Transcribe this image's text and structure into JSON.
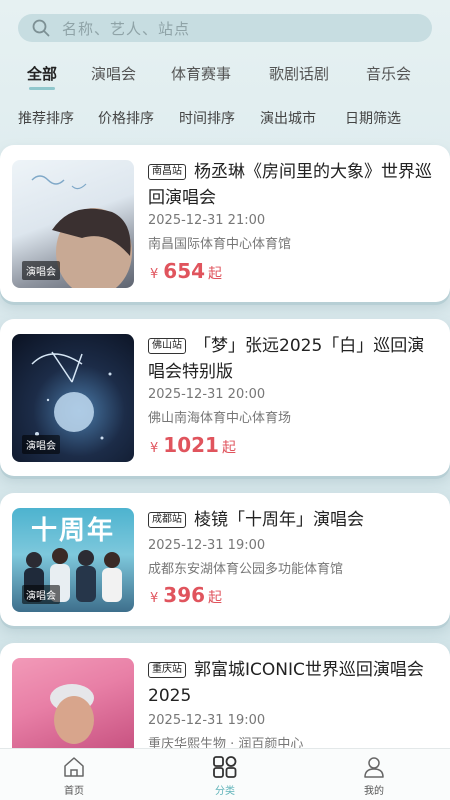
{
  "search": {
    "placeholder": "名称、艺人、站点"
  },
  "tabs": [
    "全部",
    "演唱会",
    "体育赛事",
    "歌剧话剧",
    "音乐会"
  ],
  "sorts": [
    "推荐排序",
    "价格排序",
    "时间排序",
    "演出城市",
    "日期筛选"
  ],
  "events": [
    {
      "city": "南昌站",
      "title": "杨丞琳《房间里的大象》世界巡回演唱会",
      "datetime": "2025-12-31 21:00",
      "venue": "南昌国际体育中心体育馆",
      "price_symbol": "¥",
      "price": "654",
      "price_suffix": "起",
      "poster_tag": "演唱会"
    },
    {
      "city": "佛山站",
      "title": "「梦」张远2025「白」巡回演唱会特别版",
      "datetime": "2025-12-31 20:00",
      "venue": "佛山南海体育中心体育场",
      "price_symbol": "¥",
      "price": "1021",
      "price_suffix": "起",
      "poster_tag": "演唱会"
    },
    {
      "city": "成都站",
      "title": "棱镜「十周年」演唱会",
      "datetime": "2025-12-31 19:00",
      "venue": "成都东安湖体育公园多功能体育馆",
      "price_symbol": "¥",
      "price": "396",
      "price_suffix": "起",
      "poster_tag": "演唱会",
      "poster_text": "十周年"
    },
    {
      "city": "重庆站",
      "title": "郭富城ICONIC世界巡回演唱会2025",
      "datetime": "2025-12-31 19:00",
      "venue": "重庆华熙生物 · 润百颜中心"
    }
  ],
  "bottom_nav": [
    {
      "label": "首页",
      "icon": "home-icon"
    },
    {
      "label": "分类",
      "icon": "category-icon",
      "active": true
    },
    {
      "label": "我的",
      "icon": "profile-icon"
    }
  ],
  "colors": {
    "accent": "#5fb3b9",
    "price": "#e0545d",
    "tab_indicator": "#8fc7cc"
  }
}
